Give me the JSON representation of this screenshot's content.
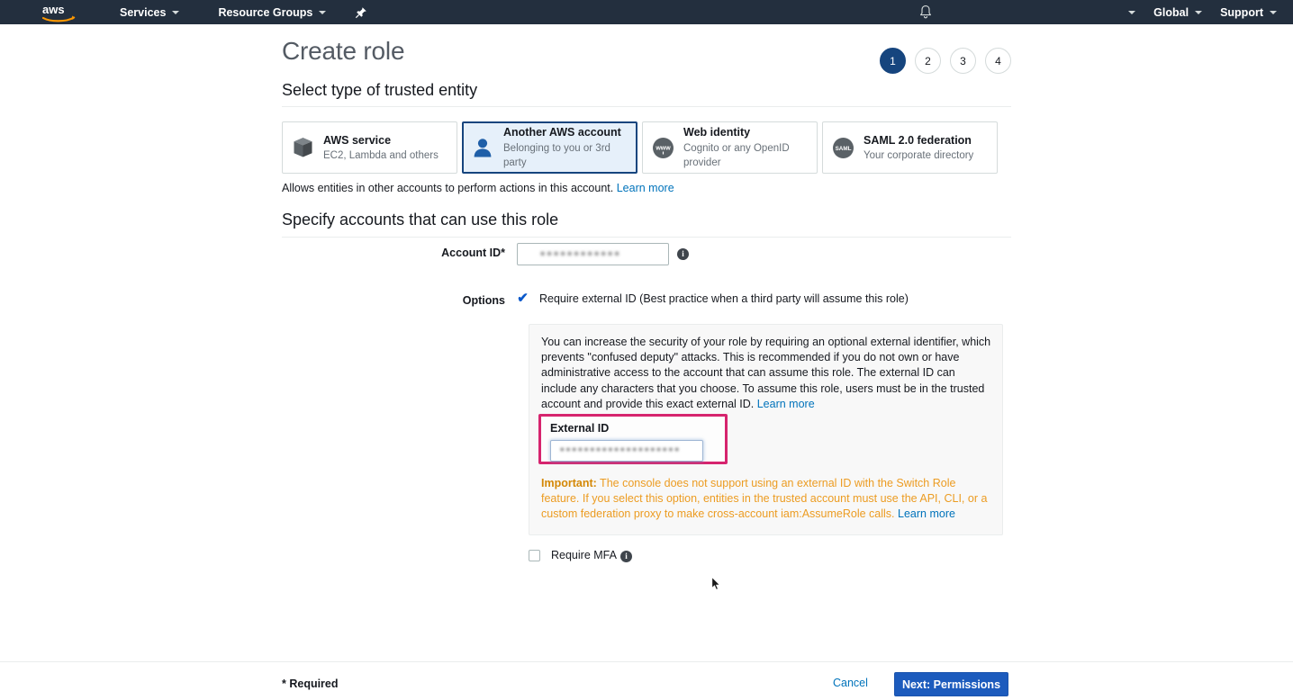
{
  "navbar": {
    "logo_alt": "aws",
    "services_label": "Services",
    "resource_groups_label": "Resource Groups",
    "pin_icon": "pin-icon",
    "bell_icon": "bell-icon",
    "account_label": "",
    "region_label": "Global",
    "support_label": "Support"
  },
  "page": {
    "title": "Create role",
    "steps": [
      {
        "number": "1",
        "active": true
      },
      {
        "number": "2",
        "active": false
      },
      {
        "number": "3",
        "active": false
      },
      {
        "number": "4",
        "active": false
      }
    ]
  },
  "trusted_entity": {
    "heading": "Select type of trusted entity",
    "cards": [
      {
        "title": "AWS service",
        "subtitle": "EC2, Lambda and others",
        "icon": "cube-icon",
        "selected": false
      },
      {
        "title": "Another AWS account",
        "subtitle": "Belonging to you or 3rd party",
        "icon": "user-icon",
        "selected": true
      },
      {
        "title": "Web identity",
        "subtitle": "Cognito or any OpenID provider",
        "icon": "www-icon",
        "selected": false
      },
      {
        "title": "SAML 2.0 federation",
        "subtitle": "Your corporate directory",
        "icon": "saml-icon",
        "selected": false
      }
    ],
    "description": "Allows entities in other accounts to perform actions in this account.",
    "learn_more": "Learn more"
  },
  "specify_accounts": {
    "heading": "Specify accounts that can use this role",
    "account_id": {
      "label": "Account ID*",
      "value": "••••••••••••",
      "placeholder": "",
      "info_icon": "info-icon"
    },
    "options": {
      "label": "Options",
      "require_external_id": {
        "label": "Require external ID (Best practice when a third party will assume this role)",
        "checked": true,
        "check_glyph": "✔"
      },
      "require_mfa": {
        "label": "Require MFA",
        "checked": false,
        "info_icon": "info-icon"
      }
    },
    "info_panel": {
      "body": "You can increase the security of your role by requiring an optional external identifier, which prevents \"confused deputy\" attacks. This is recommended if you do not own or have administrative access to the account that can assume this role. The external ID can include any characters that you choose. To assume this role, users must be in the trusted account and provide this exact external ID.",
      "body_learn_more": "Learn more",
      "external_id": {
        "label": "External ID",
        "value": "••••••••••••••••••••",
        "placeholder": ""
      },
      "important_prefix": "Important:",
      "important_text": " The console does not support using an external ID with the Switch Role feature. If you select this option, entities in the trusted account must use the API, CLI, or a custom federation proxy to make cross-account iam:AssumeRole calls.",
      "important_learn_more": "Learn more"
    }
  },
  "footer": {
    "required_note": "* Required",
    "cancel_label": "Cancel",
    "next_label": "Next: Permissions"
  },
  "colors": {
    "nav_bg": "#232f3e",
    "accent_blue": "#16457e",
    "link_blue": "#0073bb",
    "button_blue": "#1c5bbd",
    "highlight_pink": "#d6246e",
    "warning_orange": "#ec9c22",
    "selected_card_bg": "#e6f0fa",
    "panel_bg": "#f8f8f8"
  }
}
